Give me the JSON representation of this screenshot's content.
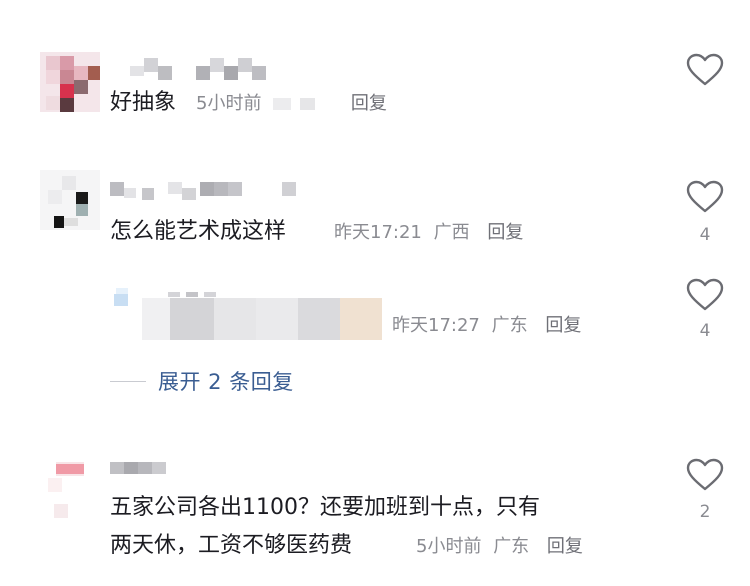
{
  "comments": [
    {
      "username": "",
      "text": "好抽象",
      "time": "5小时前",
      "location": "",
      "reply_label": "回复",
      "likes": ""
    },
    {
      "username": "",
      "text": "怎么能艺术成这样",
      "time": "昨天17:21",
      "location": "广西",
      "reply_label": "回复",
      "likes": "4",
      "replies": [
        {
          "username": "",
          "text": "",
          "time": "昨天17:27",
          "location": "广东",
          "reply_label": "回复",
          "likes": "4"
        }
      ],
      "expand_label": "展开 2 条回复"
    },
    {
      "username": "",
      "text_line1": "五家公司各出1100？还要加班到十点，只有",
      "text_line2": "两天休，工资不够医药费",
      "time": "5小时前",
      "location": "广东",
      "reply_label": "回复",
      "likes": "2"
    }
  ],
  "colors": {
    "text": "#1c1c22",
    "meta": "#8a8b91",
    "link": "#3a5d92",
    "icon": "#6b6c72"
  },
  "icons": {
    "like": "heart-outline-icon"
  }
}
